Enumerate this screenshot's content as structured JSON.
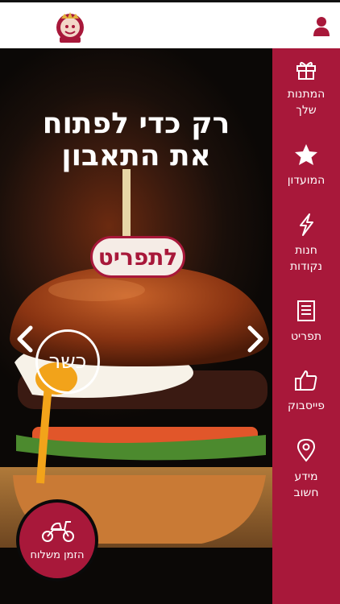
{
  "header": {
    "logo": "King David Burger logo"
  },
  "hero": {
    "headline_line1": "רק כדי לפתוח",
    "headline_line2": "את התאבון",
    "menu_button": "לתפריט",
    "kosher_badge": "כשר"
  },
  "delivery": {
    "label": "הזמן משלוח"
  },
  "sidebar": {
    "items": [
      {
        "label": "המתנות\nשלך",
        "icon": "gift-icon"
      },
      {
        "label": "המועדון",
        "icon": "star-icon"
      },
      {
        "label": "חנות\nנקודות",
        "icon": "lightning-icon"
      },
      {
        "label": "תפריט",
        "icon": "menu-book-icon"
      },
      {
        "label": "פייסבוק",
        "icon": "thumbs-up-icon"
      },
      {
        "label": "מידע\nחשוב",
        "icon": "location-pin-icon"
      }
    ]
  },
  "colors": {
    "brand": "#a8183a",
    "topbar": "#ffffff"
  }
}
